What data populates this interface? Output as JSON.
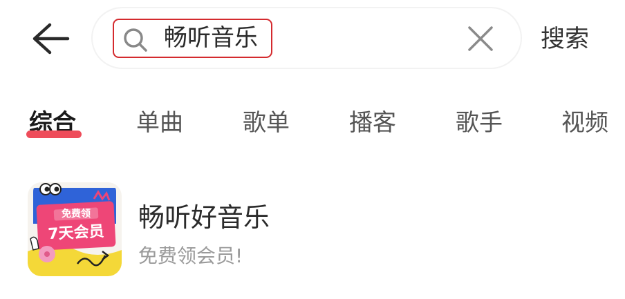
{
  "header": {
    "back_icon": "arrow-left-icon",
    "search": {
      "value": "畅听音乐",
      "search_icon": "search-icon",
      "clear_icon": "close-icon"
    },
    "search_button_label": "搜索"
  },
  "tabs": [
    {
      "label": "综合",
      "active": true
    },
    {
      "label": "单曲",
      "active": false
    },
    {
      "label": "歌单",
      "active": false
    },
    {
      "label": "播客",
      "active": false
    },
    {
      "label": "歌手",
      "active": false
    },
    {
      "label": "视频",
      "active": false
    }
  ],
  "colors": {
    "accent": "#d42a2e",
    "tab_underline": "#ee4c5a"
  },
  "result": {
    "title": "畅听好音乐",
    "subtitle": "免费领会员!",
    "icon": {
      "badge_top": "免费领",
      "badge_main": "7天会员"
    }
  }
}
